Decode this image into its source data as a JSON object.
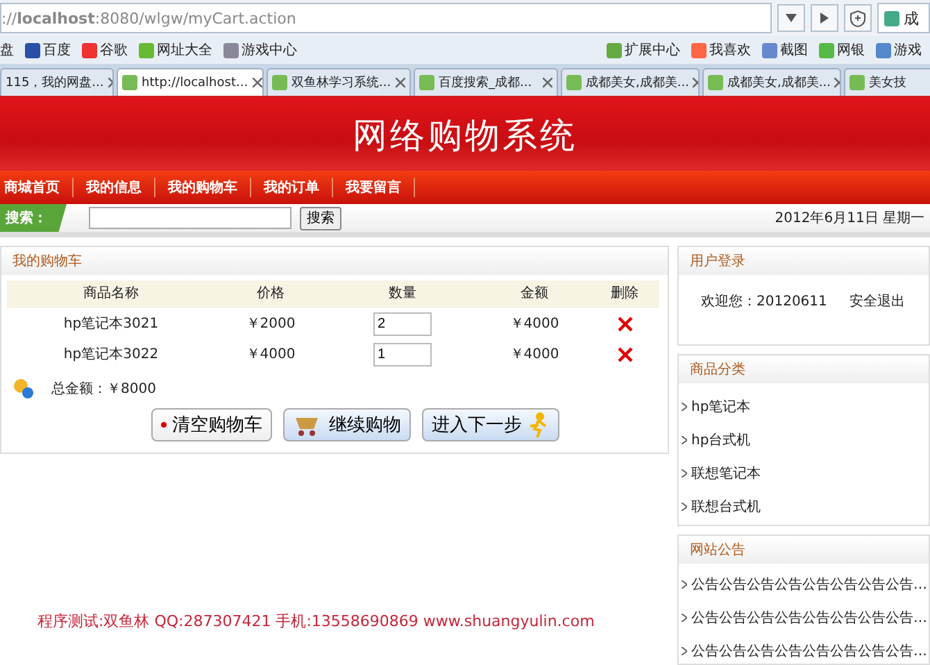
{
  "browser": {
    "address": "://**localhost**:8080/wlgw/myCart.action",
    "search_engine": "成",
    "bookmarks_left": [
      "盘",
      "百度",
      "谷歌",
      "网址大全",
      "游戏中心"
    ],
    "bookmarks_right": [
      "扩展中心",
      "我喜欢",
      "截图",
      "网银",
      "游戏"
    ],
    "tabs": [
      {
        "label": "115，我的网盘...",
        "selected": false
      },
      {
        "label": "http://localhost...",
        "selected": true
      },
      {
        "label": "双鱼林学习系统...",
        "selected": false
      },
      {
        "label": "百度搜索_成都...",
        "selected": false
      },
      {
        "label": "成都美女,成都美...",
        "selected": false
      },
      {
        "label": "成都美女,成都美...",
        "selected": false
      },
      {
        "label": "美女技",
        "selected": false
      }
    ]
  },
  "site_title": "网络购物系统",
  "nav": [
    "商城首页",
    "我的信息",
    "我的购物车",
    "我的订单",
    "我要留言"
  ],
  "search": {
    "label": "搜索：",
    "button": "搜索",
    "date": "2012年6月11日  星期一"
  },
  "cart": {
    "title": "我的购物车",
    "columns": [
      "商品名称",
      "价格",
      "数量",
      "金额",
      "删除"
    ],
    "rows": [
      {
        "name": "hp笔记本3021",
        "price": "￥2000",
        "qty": "2",
        "amount": "￥4000"
      },
      {
        "name": "hp笔记本3022",
        "price": "￥4000",
        "qty": "1",
        "amount": "￥4000"
      }
    ],
    "total": "总金额：￥8000",
    "buttons": [
      "清空购物车",
      "继续购物",
      "进入下一步"
    ]
  },
  "footer": "程序测试:双鱼林 QQ:287307421 手机:13558690869 www.shuangyulin.com",
  "login": {
    "title": "用户登录",
    "welcome": "欢迎您：20120611",
    "logout": "安全退出"
  },
  "categories": {
    "title": "商品分类",
    "items": [
      "hp笔记本",
      "hp台式机",
      "联想笔记本",
      "联想台式机"
    ]
  },
  "notices": {
    "title": "网站公告",
    "items": [
      "公告公告公告公告公告公告公告公告…",
      "公告公告公告公告公告公告公告公告…",
      "公告公告公告公告公告公告公告公告…"
    ]
  }
}
